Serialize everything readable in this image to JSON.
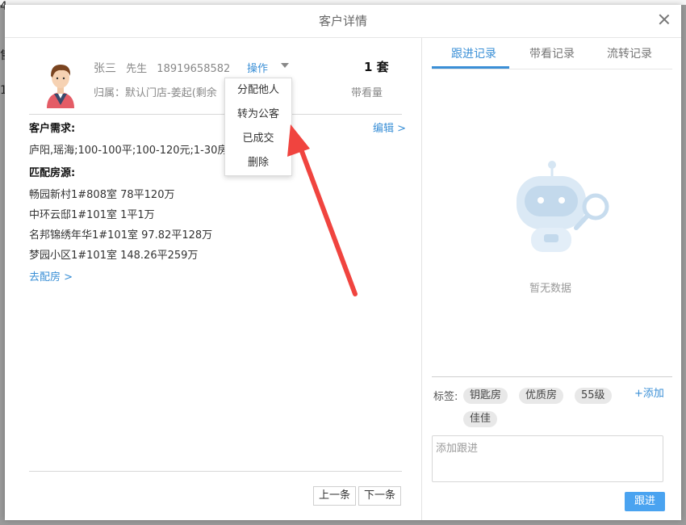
{
  "background": {
    "fragments": [
      "4",
      "售",
      "1"
    ]
  },
  "modal": {
    "title": "客户详情"
  },
  "customer": {
    "name": "张三",
    "salutation": "先生",
    "phone": "18919658582",
    "actions_label": "操作",
    "count": "1 套",
    "belong": "归属：默认门店-姜起(剩余",
    "views_label": "带看量"
  },
  "dropdown": {
    "items": [
      "分配他人",
      "转为公客",
      "已成交",
      "删除"
    ]
  },
  "requirements": {
    "title": "客户需求:",
    "edit": "编辑 >",
    "text": "庐阳,瑶海;100-100平;100-120元;1-30房"
  },
  "matched": {
    "title": "匹配房源:",
    "houses": [
      "畅园新村1#808室 78平120万",
      "中环云邸1#101室 1平1万",
      "名邦锦绣年华1#101室 97.82平128万",
      "梦园小区1#101室 148.26平259万"
    ],
    "goto": "去配房 >"
  },
  "pager": {
    "prev": "上一条",
    "next": "下一条"
  },
  "tabs": [
    {
      "label": "跟进记录",
      "active": true
    },
    {
      "label": "带看记录",
      "active": false
    },
    {
      "label": "流转记录",
      "active": false
    }
  ],
  "empty_state": {
    "text": "暂无数据",
    "icon": "robot-magnifier-icon"
  },
  "tags": {
    "label": "标签:",
    "items": [
      "钥匙房",
      "优质房",
      "55级",
      "佳佳"
    ],
    "add": "+添加"
  },
  "followup": {
    "placeholder": "添加跟进",
    "button": "跟进"
  },
  "colors": {
    "accent": "#3a8fd6",
    "button": "#4aa3f0",
    "arrow": "#f0443f"
  }
}
